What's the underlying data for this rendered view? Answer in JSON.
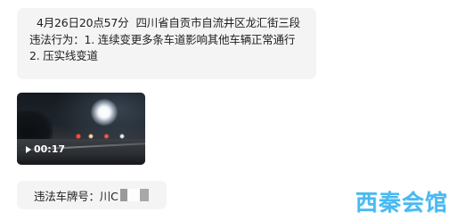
{
  "message": {
    "time": "4月26日20点57分",
    "location": "四川省自贡市自流井区龙汇街三段",
    "violation_line1": "违法行为：1. 连续变更多条车道影响其他车辆正常通行",
    "violation_line2": "2. 压实线变道"
  },
  "video": {
    "duration": "00:17",
    "icon": "play-icon"
  },
  "plate": {
    "label": "违法车牌号：川C"
  },
  "watermark": {
    "text": "西秦会馆",
    "color": "#49b9f0"
  }
}
